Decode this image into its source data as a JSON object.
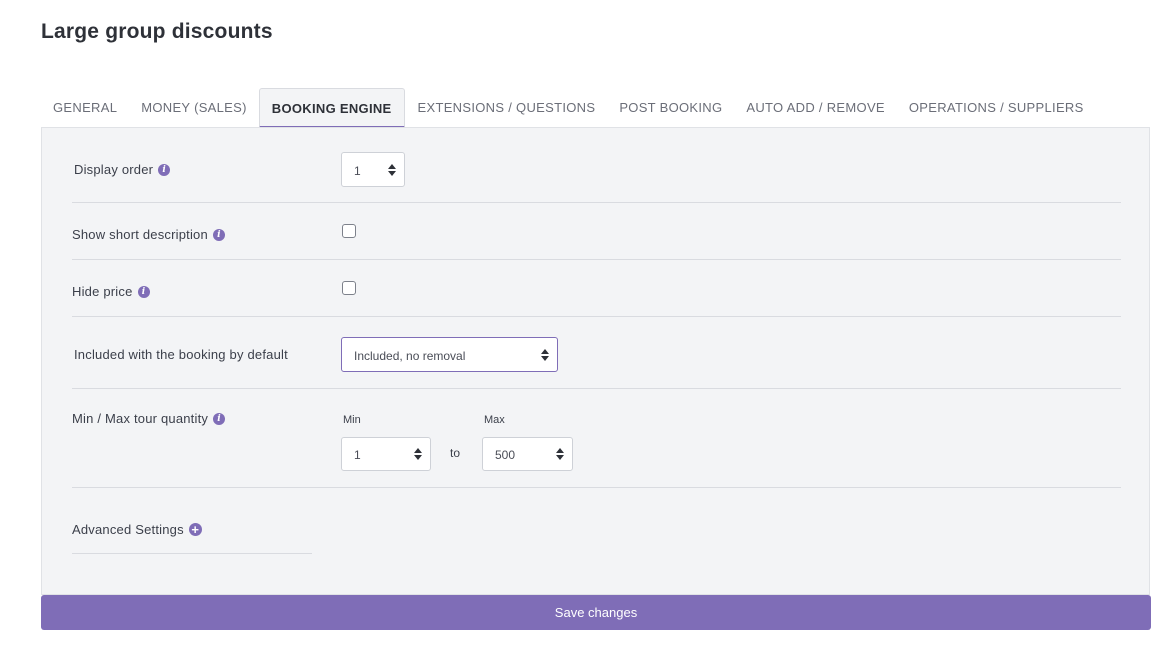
{
  "page": {
    "title": "Large group discounts"
  },
  "tabs": [
    {
      "label": "GENERAL",
      "active": false
    },
    {
      "label": "MONEY (SALES)",
      "active": false
    },
    {
      "label": "BOOKING ENGINE",
      "active": true
    },
    {
      "label": "EXTENSIONS / QUESTIONS",
      "active": false
    },
    {
      "label": "POST BOOKING",
      "active": false
    },
    {
      "label": "AUTO ADD / REMOVE",
      "active": false
    },
    {
      "label": "OPERATIONS / SUPPLIERS",
      "active": false
    }
  ],
  "form": {
    "display_order": {
      "label": "Display order",
      "value": "1"
    },
    "show_short_description": {
      "label": "Show short description",
      "checked": false
    },
    "hide_price": {
      "label": "Hide price",
      "checked": false
    },
    "included_default": {
      "label": "Included with the booking by default",
      "value": "Included, no removal"
    },
    "min_max": {
      "label": "Min / Max tour quantity",
      "min_label": "Min",
      "min_value": "1",
      "to_text": "to",
      "max_label": "Max",
      "max_value": "500"
    },
    "advanced": {
      "label": "Advanced Settings"
    }
  },
  "actions": {
    "save_label": "Save changes"
  },
  "colors": {
    "accent": "#7f6db7",
    "panel_bg": "#f3f4f6",
    "divider": "#d9dbe0"
  },
  "icons": {
    "info": "info-icon",
    "plus": "plus-circle-icon",
    "spinner": "spinner-arrows-icon"
  }
}
